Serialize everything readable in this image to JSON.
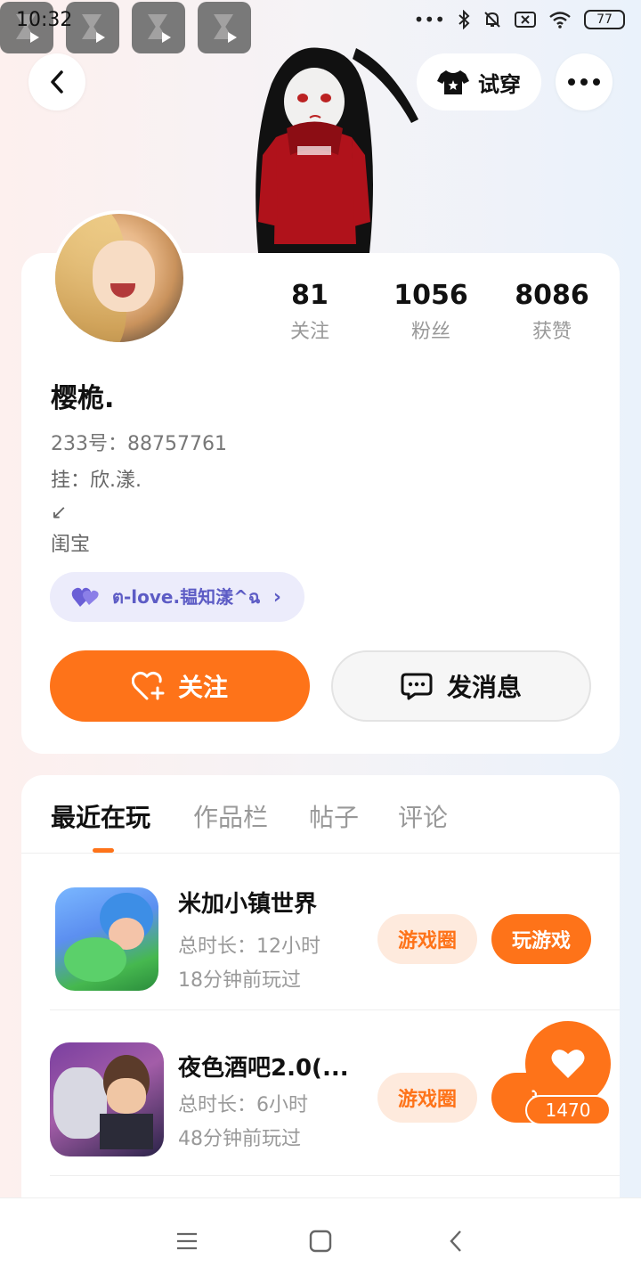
{
  "status_bar": {
    "time": "10:32",
    "battery": "77"
  },
  "header": {
    "try_on_label": "试穿"
  },
  "profile": {
    "stats": [
      {
        "value": "81",
        "label": "关注"
      },
      {
        "value": "1056",
        "label": "粉丝"
      },
      {
        "value": "8086",
        "label": "获赞"
      }
    ],
    "username": "樱桅.",
    "uid": "233号：88757761",
    "bio": "挂：欣.漾.\n↙\n闺宝",
    "relation_tag": "ต-love.韫知漾^ฉ",
    "follow_label": "关注",
    "message_label": "发消息"
  },
  "tabs": [
    "最近在玩",
    "作品栏",
    "帖子",
    "评论"
  ],
  "games": [
    {
      "name": "米加小镇世界",
      "duration": "总时长：12小时",
      "last_played": "18分钟前玩过",
      "circle_label": "游戏圈",
      "play_label": "玩游戏"
    },
    {
      "name": "夜色酒吧2.0(...",
      "duration": "总时长：6小时",
      "last_played": "48分钟前玩过",
      "circle_label": "游戏圈",
      "play_label": "玩"
    }
  ],
  "like": {
    "count": "1470"
  },
  "colors": {
    "accent": "#fe7319",
    "tag_bg": "#ececfb",
    "tag_text": "#5d5cc5"
  }
}
